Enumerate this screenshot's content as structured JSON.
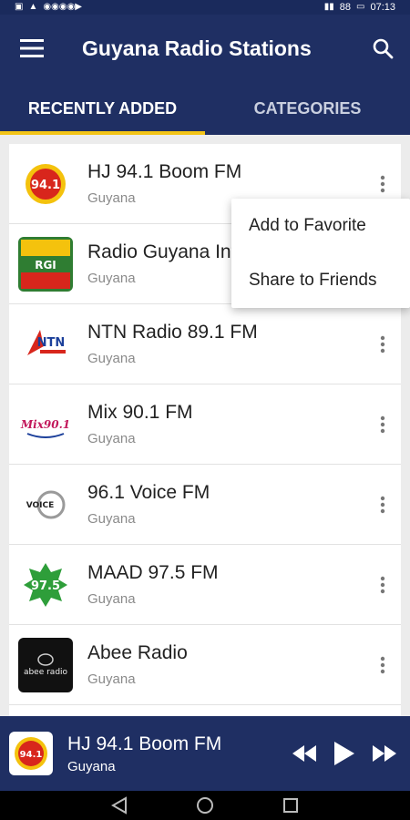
{
  "status_bar": {
    "time": "07:13",
    "battery": "88"
  },
  "app_bar": {
    "title": "Guyana Radio Stations",
    "menu_icon": "hamburger-menu-icon",
    "search_icon": "search-icon"
  },
  "tabs": [
    {
      "label": "RECENTLY ADDED",
      "active": true
    },
    {
      "label": "CATEGORIES",
      "active": false
    }
  ],
  "stations": [
    {
      "name": "HJ 94.1 Boom FM",
      "country": "Guyana",
      "logo_text": "94.1",
      "logo_color": "#d8261c"
    },
    {
      "name": "Radio Guyana Int",
      "country": "Guyana",
      "logo_text": "RGI",
      "logo_color": "#2f7d32"
    },
    {
      "name": "NTN Radio 89.1 FM",
      "country": "Guyana",
      "logo_text": "NTN",
      "logo_color": "#1b3f9a"
    },
    {
      "name": "Mix 90.1 FM",
      "country": "Guyana",
      "logo_text": "Mix90.1",
      "logo_color": "#c2185b"
    },
    {
      "name": "96.1 Voice FM",
      "country": "Guyana",
      "logo_text": "VOICE",
      "logo_color": "#555555"
    },
    {
      "name": "MAAD 97.5 FM",
      "country": "Guyana",
      "logo_text": "97.5",
      "logo_color": "#2e9e3a"
    },
    {
      "name": "Abee Radio",
      "country": "Guyana",
      "logo_text": "abee radio",
      "logo_color": "#111111"
    }
  ],
  "popup_menu": {
    "items": [
      "Add to Favorite",
      "Share to Friends"
    ]
  },
  "player": {
    "title": "HJ 94.1 Boom FM",
    "subtitle": "Guyana",
    "logo_text": "94.1"
  },
  "colors": {
    "primary": "#1f2f63",
    "accent": "#f2c417"
  }
}
